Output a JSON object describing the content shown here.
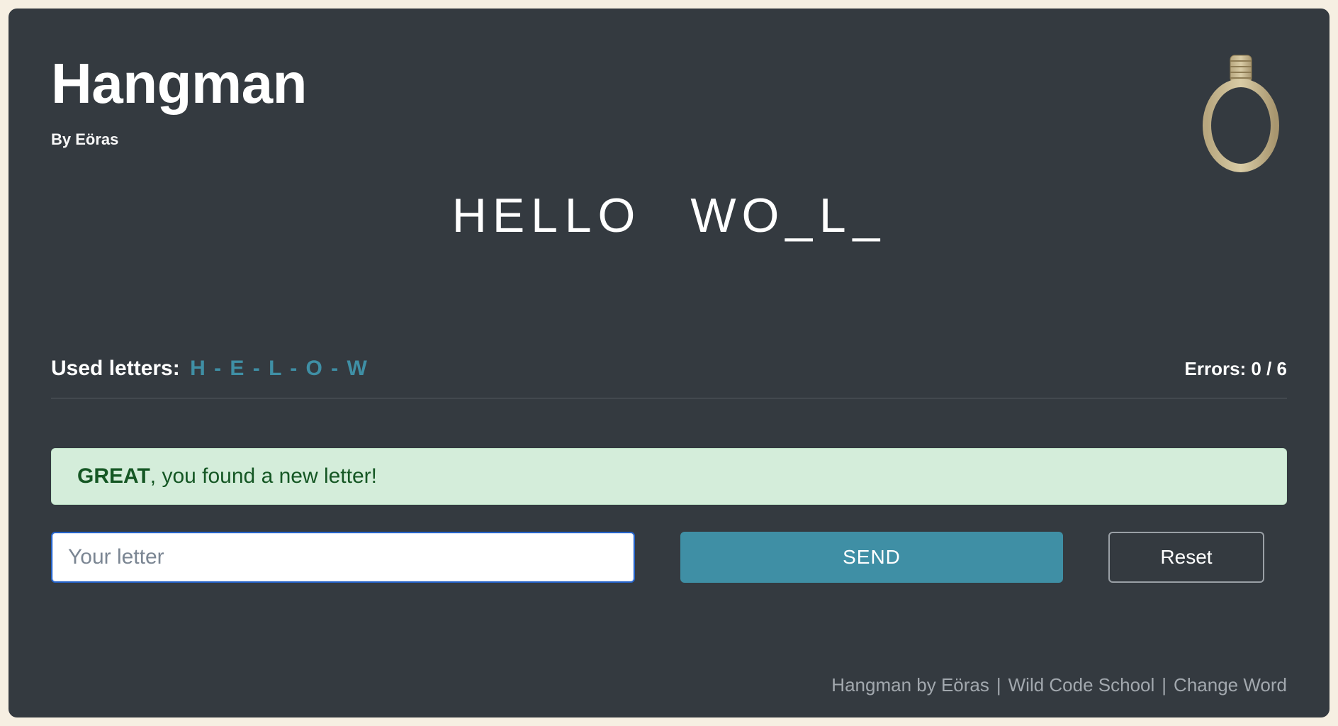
{
  "header": {
    "title": "Hangman",
    "byline": "By Eöras"
  },
  "word": {
    "segments": [
      [
        "H",
        "E",
        "L",
        "L",
        "O"
      ],
      [
        "W",
        "O",
        "_",
        "L",
        "_"
      ]
    ]
  },
  "stats": {
    "used_label": "Used letters:",
    "used_letters": "H - E - L - O - W",
    "errors_text": "Errors: 0 / 6"
  },
  "alert": {
    "strong": "GREAT",
    "rest": ", you found a new letter!"
  },
  "form": {
    "placeholder": "Your letter",
    "value": "",
    "send_label": "SEND",
    "reset_label": "Reset"
  },
  "footer": {
    "credit": "Hangman by Eöras",
    "school": "Wild Code School",
    "change_word": "Change Word"
  },
  "colors": {
    "brand": "#3f8fa5",
    "card_bg": "#343a40",
    "page_bg": "#f6efe2",
    "alert_bg": "#d4edda",
    "alert_text": "#155724"
  },
  "icons": {
    "noose": "noose-icon"
  }
}
